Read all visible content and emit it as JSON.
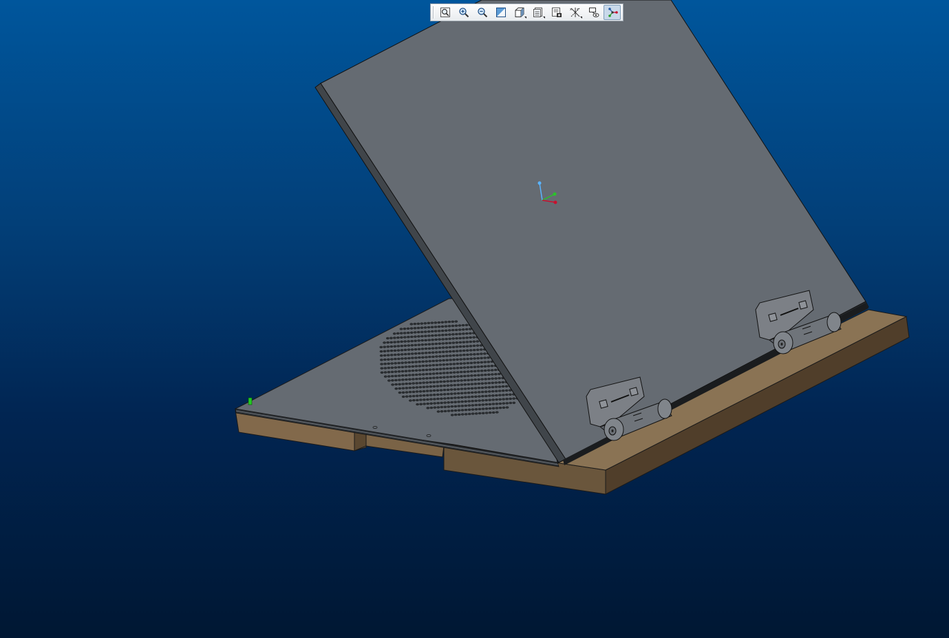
{
  "colors": {
    "background_top": "#00569c",
    "background_bottom": "#001733",
    "sheet_metal": "#656b72",
    "wood_top": "#8a7354",
    "wood_side": "#503e2a",
    "hinge": "#7c8086",
    "csys_x": "#c8102e",
    "csys_y": "#2ac32a",
    "csys_z": "#5ab4ff"
  },
  "toolbar": {
    "buttons": [
      {
        "name": "refit-view-button",
        "icon": "zoom-fit-icon",
        "flyout": false,
        "active": false
      },
      {
        "name": "zoom-in-button",
        "icon": "zoom-in-icon",
        "flyout": false,
        "active": false
      },
      {
        "name": "zoom-out-button",
        "icon": "zoom-out-icon",
        "flyout": false,
        "active": false
      },
      {
        "name": "repaint-button",
        "icon": "repaint-icon",
        "flyout": false,
        "active": false
      },
      {
        "name": "display-style-button",
        "icon": "display-style-cube-icon",
        "flyout": true,
        "active": false
      },
      {
        "name": "saved-views-button",
        "icon": "saved-orientations-icon",
        "flyout": true,
        "active": false
      },
      {
        "name": "view-manager-button",
        "icon": "view-manager-icon",
        "flyout": false,
        "active": false
      },
      {
        "name": "datum-display-button",
        "icon": "datum-display-filters-icon",
        "flyout": true,
        "active": false
      },
      {
        "name": "annotation-display-button",
        "icon": "annotation-display-icon",
        "flyout": false,
        "active": false
      },
      {
        "name": "spin-center-button",
        "icon": "spin-center-icon",
        "flyout": false,
        "active": true
      }
    ]
  }
}
